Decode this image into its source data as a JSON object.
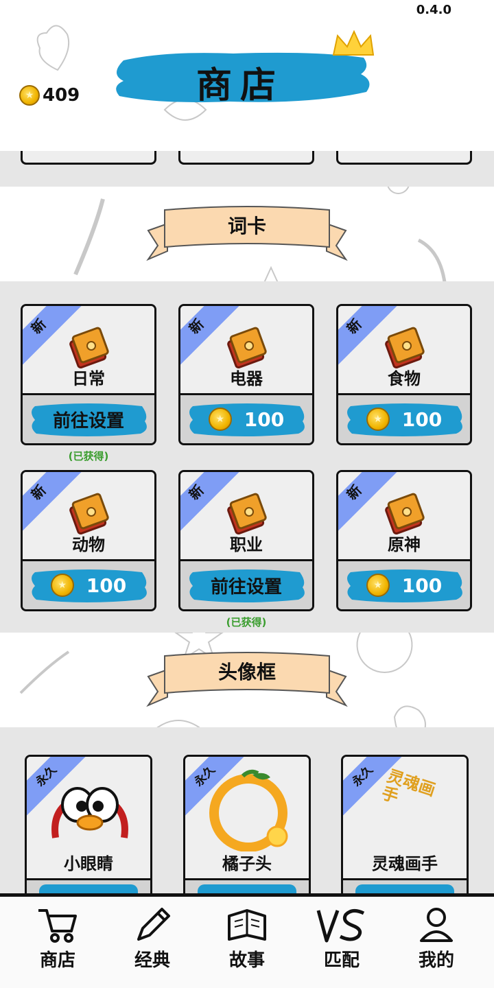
{
  "header": {
    "version": "0.4.0",
    "title": "商店",
    "coins": "409"
  },
  "sections": {
    "word_cards": {
      "ribbon_label": "词卡",
      "cards": [
        {
          "tag": "新",
          "label": "日常",
          "action": "前往设置",
          "owned_note": "(已获得)"
        },
        {
          "tag": "新",
          "label": "电器",
          "price": "100"
        },
        {
          "tag": "新",
          "label": "食物",
          "price": "100"
        },
        {
          "tag": "新",
          "label": "动物",
          "price": "100"
        },
        {
          "tag": "新",
          "label": "职业",
          "action": "前往设置",
          "owned_note": "(已获得)"
        },
        {
          "tag": "新",
          "label": "原神",
          "price": "100"
        }
      ]
    },
    "avatar_frames": {
      "ribbon_label": "头像框",
      "cards": [
        {
          "tag": "永久",
          "label": "小眼睛"
        },
        {
          "tag": "永久",
          "label": "橘子头"
        },
        {
          "tag": "永久",
          "label": "灵魂画手",
          "art_text": "灵魂画手"
        }
      ]
    }
  },
  "nav": {
    "items": [
      {
        "label": "商店",
        "icon": "cart-icon"
      },
      {
        "label": "经典",
        "icon": "pencil-icon"
      },
      {
        "label": "故事",
        "icon": "book-icon"
      },
      {
        "label": "匹配",
        "icon": "vs-icon"
      },
      {
        "label": "我的",
        "icon": "person-icon"
      }
    ]
  },
  "colors": {
    "accent_blue": "#1f9bd0",
    "tag_blue": "#7f9df5",
    "owned_green": "#3a9d2e",
    "band_grey": "#e6e6e6",
    "ribbon_peach": "#fbd9b0"
  }
}
